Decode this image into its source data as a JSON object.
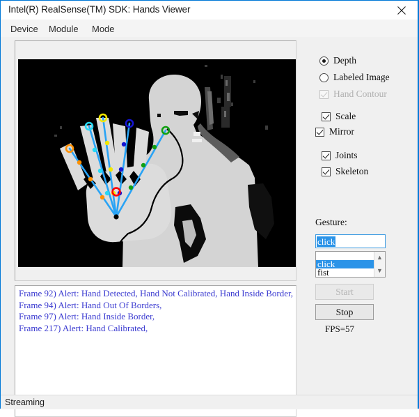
{
  "window": {
    "title": "Intel(R) RealSense(TM) SDK: Hands Viewer",
    "close_icon": "close-icon",
    "accent_color": "#0078d7"
  },
  "menubar": {
    "items": [
      {
        "label": "Device"
      },
      {
        "label": "Module"
      },
      {
        "label": "Mode"
      }
    ]
  },
  "viewer": {
    "name": "depth-stream-viewer",
    "background_color": "#000000",
    "silhouette_color": "#d8d8d8",
    "skeleton": {
      "bone_color": "#29a3f5",
      "palm_center_marker_color": "#ff0000",
      "wrist_marker_color": "#000000",
      "fingertip_colors": [
        "#ff9000",
        "#25d8f5",
        "#f2e800",
        "#1414d0",
        "#11a011"
      ]
    }
  },
  "controls": {
    "display_mode": {
      "selected": "Depth",
      "options": [
        {
          "label": "Depth",
          "checked": true
        },
        {
          "label": "Labeled Image",
          "checked": false
        }
      ]
    },
    "checkboxes": [
      {
        "label": "Hand Contour",
        "checked": true,
        "enabled": false
      },
      {
        "label": "Scale",
        "checked": true,
        "enabled": true
      },
      {
        "label": "Mirror",
        "checked": true,
        "enabled": true
      },
      {
        "label": "Joints",
        "checked": true,
        "enabled": true
      },
      {
        "label": "Skeleton",
        "checked": true,
        "enabled": true
      }
    ],
    "gesture": {
      "label": "Gesture:",
      "input_value": "click",
      "input_placeholder": "",
      "options": [
        "",
        "click",
        "fist"
      ],
      "selected_option": "click",
      "scroll_up_icon": "chevron-up-icon",
      "scroll_down_icon": "chevron-down-icon"
    },
    "start_button": {
      "label": "Start",
      "enabled": false
    },
    "stop_button": {
      "label": "Stop",
      "enabled": true
    },
    "fps": "FPS=57"
  },
  "log": {
    "text_color": "#3a3ad0",
    "lines": [
      "Frame 92) Alert: Hand Detected, Hand Not Calibrated, Hand Inside Border,",
      "Frame 94) Alert: Hand Out Of Borders,",
      "Frame 97) Alert: Hand Inside Border,",
      "Frame 217) Alert: Hand Calibrated,"
    ]
  },
  "statusbar": {
    "text": "Streaming"
  }
}
